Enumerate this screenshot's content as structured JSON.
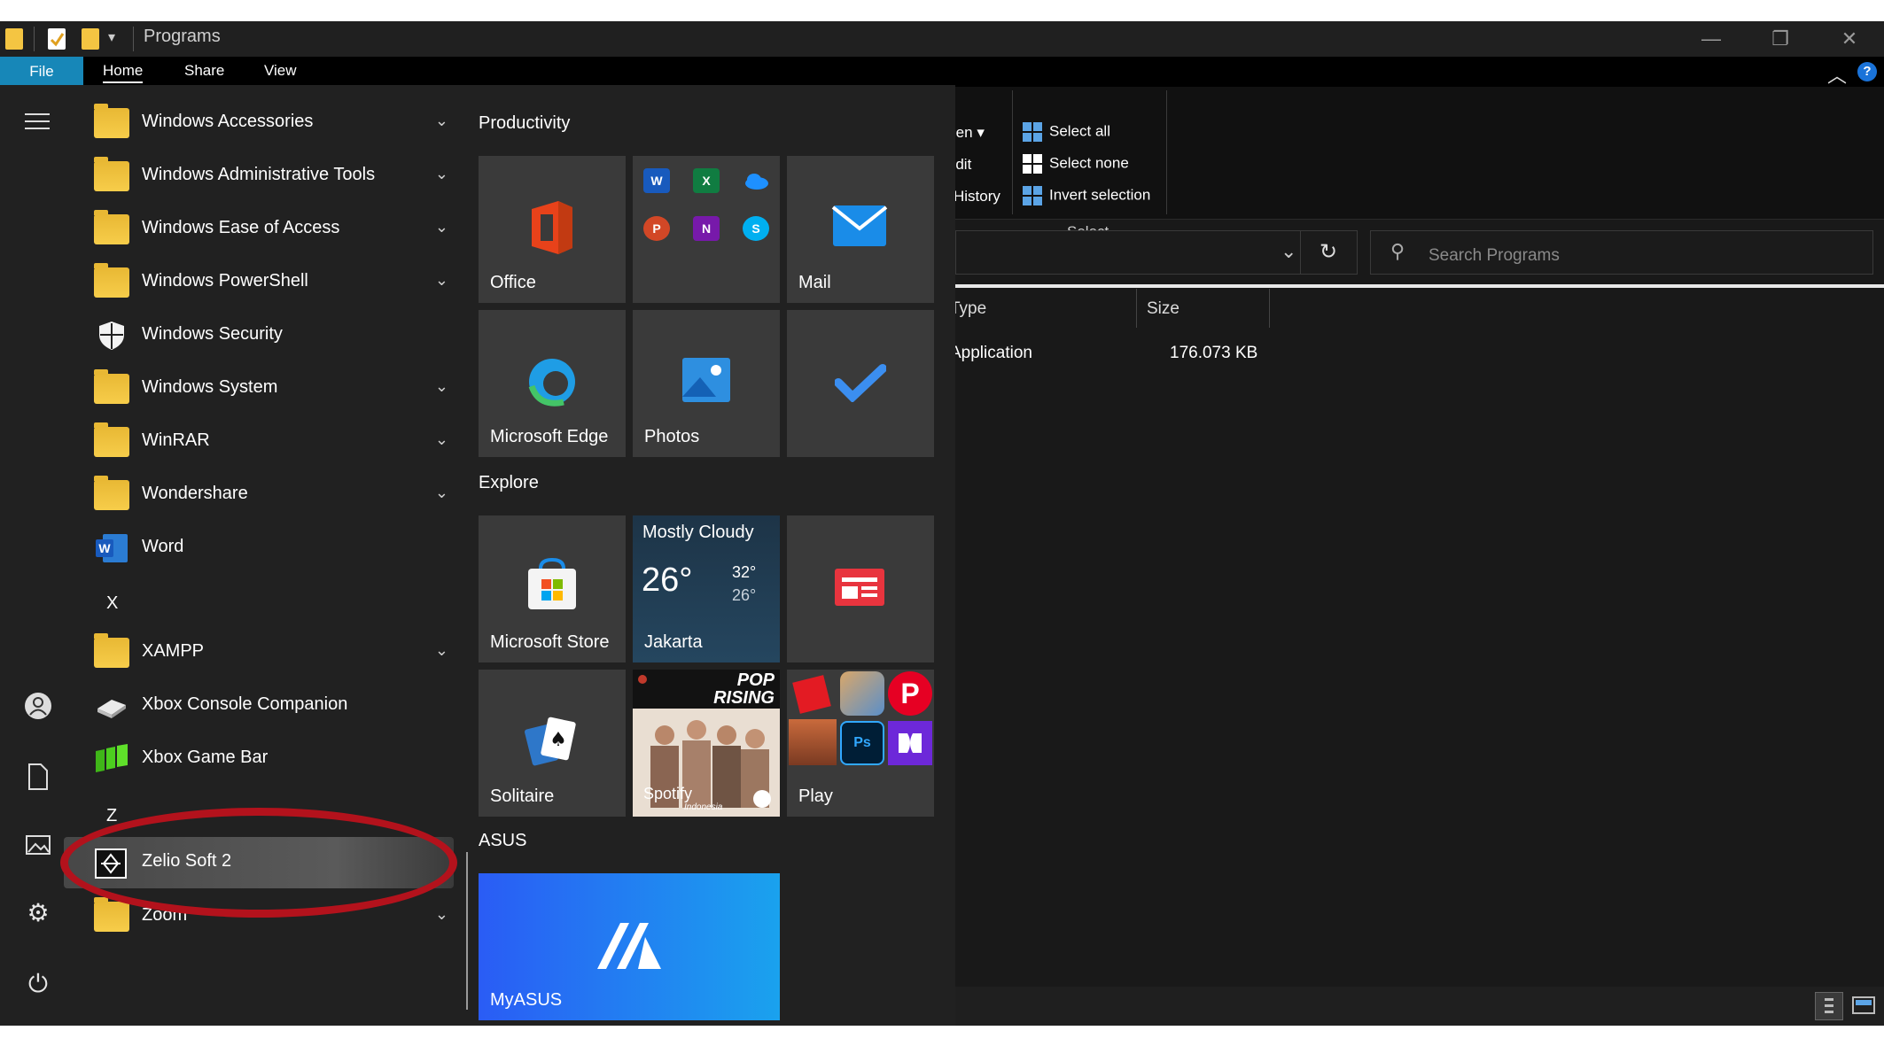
{
  "explorer": {
    "title": "Programs",
    "tabs": {
      "file": "File",
      "home": "Home",
      "share": "Share",
      "view": "View"
    },
    "help_glyph": "?",
    "ribbon": {
      "open": "Open",
      "edit": "Edit",
      "history": "History",
      "select_all": "Select all",
      "select_none": "Select none",
      "invert_selection": "Invert selection",
      "select_group": "Select"
    },
    "search_placeholder": "Search Programs",
    "columns": {
      "type": "Type",
      "size": "Size"
    },
    "row": {
      "type": "Application",
      "size": "176.073 KB"
    }
  },
  "start_menu": {
    "apps": [
      {
        "label": "Windows Accessories",
        "icon": "folder-icon",
        "expandable": true
      },
      {
        "label": "Windows Administrative Tools",
        "icon": "folder-icon",
        "expandable": true
      },
      {
        "label": "Windows Ease of Access",
        "icon": "folder-icon",
        "expandable": true
      },
      {
        "label": "Windows PowerShell",
        "icon": "folder-icon",
        "expandable": true
      },
      {
        "label": "Windows Security",
        "icon": "shield-icon",
        "expandable": false
      },
      {
        "label": "Windows System",
        "icon": "folder-icon",
        "expandable": true
      },
      {
        "label": "WinRAR",
        "icon": "folder-icon",
        "expandable": true
      },
      {
        "label": "Wondershare",
        "icon": "folder-icon",
        "expandable": true
      },
      {
        "label": "Word",
        "icon": "word-icon",
        "expandable": false
      },
      {
        "label": "XAMPP",
        "icon": "folder-icon",
        "expandable": true
      },
      {
        "label": "Xbox Console Companion",
        "icon": "xbox-icon",
        "expandable": false
      },
      {
        "label": "Xbox Game Bar",
        "icon": "xbox-game-bar-icon",
        "expandable": false
      },
      {
        "label": "Zelio Soft 2",
        "icon": "zelio-icon",
        "expandable": false,
        "highlighted": true
      },
      {
        "label": "Zoom",
        "icon": "folder-icon",
        "expandable": true
      }
    ],
    "letters": {
      "x": "X",
      "z": "Z"
    },
    "groups": {
      "productivity": "Productivity",
      "explore": "Explore",
      "asus": "ASUS"
    },
    "tiles": {
      "office": "Office",
      "mail": "Mail",
      "edge": "Microsoft Edge",
      "photos": "Photos",
      "store": "Microsoft Store",
      "play": "Play",
      "solitaire": "Solitaire",
      "myasus": "MyASUS",
      "spotify_line1": "POP",
      "spotify_line2": "RISING",
      "spotify_brand": "Spotify",
      "spotify_country": "Indonesia"
    },
    "weather": {
      "condition": "Mostly Cloudy",
      "temp": "26°",
      "high": "32°",
      "low": "26°",
      "city": "Jakarta"
    },
    "mini_icons": {
      "word": "W",
      "excel": "X",
      "powerpoint": "P",
      "onenote": "N",
      "skype": "S",
      "photoshop": "Ps"
    }
  },
  "colors": {
    "accent": "#1787b8",
    "highlight_ring": "#b3121c",
    "tile_bg": "#3a3a3a",
    "myasus_from": "#2a5cf5",
    "myasus_to": "#1aa2ee"
  }
}
